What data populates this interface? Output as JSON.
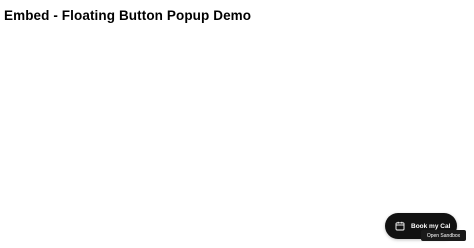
{
  "page": {
    "title": "Embed - Floating Button Popup Demo"
  },
  "floating_button": {
    "label": "Book my Cal",
    "icon": "calendar-icon",
    "background": "#111111",
    "text_color": "#ffffff"
  },
  "sandbox_link": {
    "label": "Open Sandbox"
  }
}
